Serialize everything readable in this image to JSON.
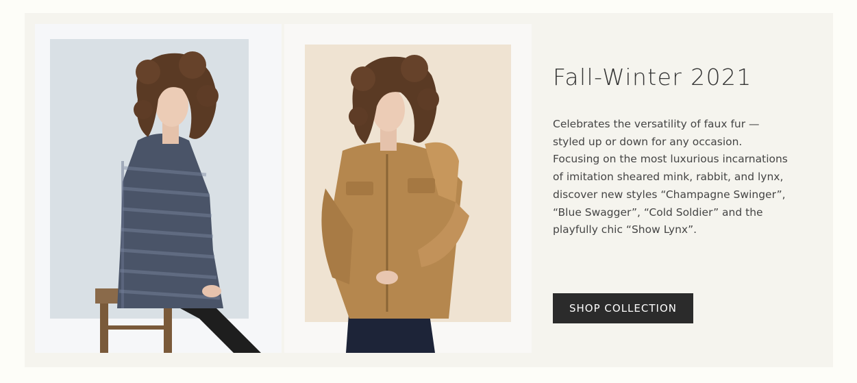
{
  "collection": {
    "title": "Fall-Winter 2021",
    "description": "Celebrates the versatility of faux fur — styled up or down for any occasion. Focusing on the most luxurious incarnations of imitation sheared mink, rabbit, and lynx, discover new styles “Champagne Swinger”, “Blue Swagger”, “Cold Soldier” and the playfully chic “Show Lynx”.",
    "cta_label": "SHOP COLLECTION"
  },
  "images": [
    {
      "name": "model-blue-fur-coat-photo"
    },
    {
      "name": "model-camel-fur-jacket-photo"
    }
  ]
}
